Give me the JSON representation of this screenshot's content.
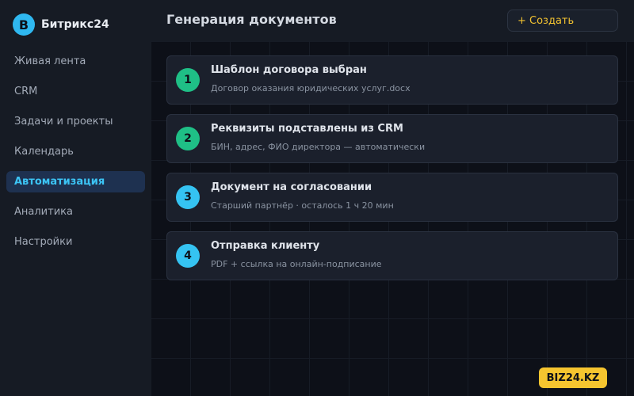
{
  "brand": {
    "logo_letter": "B",
    "name": "Битрикс24"
  },
  "sidebar": {
    "items": [
      {
        "label": "Живая лента",
        "active": false
      },
      {
        "label": "CRM",
        "active": false
      },
      {
        "label": "Задачи и проекты",
        "active": false
      },
      {
        "label": "Календарь",
        "active": false
      },
      {
        "label": "Автоматизация",
        "active": true
      },
      {
        "label": "Аналитика",
        "active": false
      },
      {
        "label": "Настройки",
        "active": false
      }
    ]
  },
  "header": {
    "title": "Генерация документов",
    "create_label": "+ Создать"
  },
  "steps": [
    {
      "number": "1",
      "title": "Шаблон договора выбран",
      "subtitle": "Договор оказания юридических услуг.docx",
      "color": "#1fbf86",
      "status": "done"
    },
    {
      "number": "2",
      "title": "Реквизиты подставлены из CRM",
      "subtitle": "БИН, адрес, ФИО директора — автоматически",
      "color": "#1fbf86",
      "status": "done"
    },
    {
      "number": "3",
      "title": "Документ на согласовании",
      "subtitle": "Старший партнёр · осталось 1 ч 20 мин",
      "color": "#35c3f2",
      "status": "pending"
    },
    {
      "number": "4",
      "title": "Отправка клиенту",
      "subtitle": "PDF + ссылка на онлайн-подписание",
      "color": "#35c3f2",
      "status": "pending"
    }
  ],
  "badge": {
    "label": "BIZ24.KZ"
  },
  "colors": {
    "accent": "#3cc4f5",
    "brand": "#2fb8f0",
    "done": "#1fbf86",
    "pending": "#35c3f2",
    "create": "#f2c230",
    "badge": "#f6c52f"
  }
}
